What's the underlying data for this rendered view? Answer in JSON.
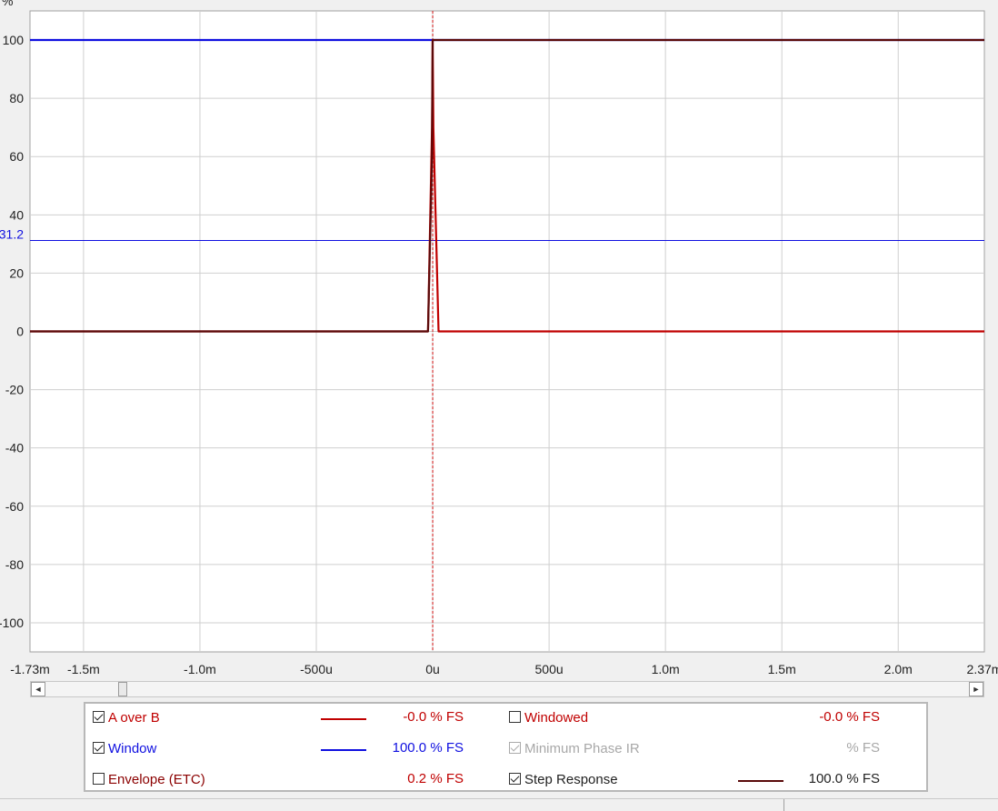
{
  "chart_data": {
    "type": "line",
    "y_unit": "%",
    "x_ticks": [
      "-1.73m",
      "-1.5m",
      "-1.0m",
      "-500u",
      "0u",
      "500u",
      "1.0m",
      "1.5m",
      "2.0m",
      "2.37m"
    ],
    "x_tick_values": [
      -1.73,
      -1.5,
      -1.0,
      -0.5,
      0,
      0.5,
      1.0,
      1.5,
      2.0,
      2.37
    ],
    "x_unit": "ms",
    "xlim": [
      -1.73,
      2.37
    ],
    "y_ticks": [
      "100",
      "80",
      "60",
      "40",
      "20",
      "0",
      "-20",
      "-40",
      "-60",
      "-80",
      "-100"
    ],
    "y_tick_values": [
      100,
      80,
      60,
      40,
      20,
      0,
      -20,
      -40,
      -60,
      -80,
      -100
    ],
    "ylim": [
      -110,
      110
    ],
    "cursor_x": 0,
    "marker": {
      "y": 31.2,
      "label": "31.2"
    },
    "series": [
      {
        "name": "Window",
        "color": "#1010e0",
        "x": [
          -1.73,
          0,
          0.0001,
          2.37
        ],
        "y": [
          100,
          100,
          100,
          100
        ]
      },
      {
        "name": "A over B",
        "color": "#c00000",
        "x": [
          -1.73,
          -0.02,
          -0.003,
          0,
          0.003,
          0.025,
          2.37
        ],
        "y": [
          0,
          0,
          70,
          100,
          70,
          0,
          0
        ]
      },
      {
        "name": "Step Response",
        "color": "#5a0a0a",
        "x": [
          -1.73,
          -0.02,
          -0.003,
          0,
          2.37
        ],
        "y": [
          0,
          0,
          60,
          100,
          100
        ]
      }
    ],
    "grid": true
  },
  "scrollbar": {
    "left_arrow": "◄",
    "right_arrow": "►"
  },
  "legend": {
    "rows": [
      {
        "label": "A over B",
        "checked": true,
        "label_color": "#c00000",
        "swatch": "#c00000",
        "value": "-0.0 % FS",
        "value_color": "#c00000"
      },
      {
        "label": "Window",
        "checked": true,
        "label_color": "#1010e0",
        "swatch": "#1010e0",
        "value": "100.0 % FS",
        "value_color": "#1010e0"
      },
      {
        "label": "Envelope (ETC)",
        "checked": false,
        "label_color": "#8b0000",
        "swatch": "",
        "value": "0.2 % FS",
        "value_color": "#c00000"
      }
    ],
    "rows_right": [
      {
        "label": "Windowed",
        "checked": false,
        "label_color": "#c00000",
        "swatch": "",
        "value": "-0.0 % FS",
        "value_color": "#c00000"
      },
      {
        "label": "Minimum Phase IR",
        "checked": true,
        "disabled": true,
        "label_color": "#a8a8a8",
        "swatch": "",
        "value": "% FS",
        "value_color": "#a8a8a8"
      },
      {
        "label": "Step Response",
        "checked": true,
        "label_color": "#222222",
        "swatch": "#5a0a0a",
        "value": "100.0 % FS",
        "value_color": "#222222"
      }
    ]
  }
}
